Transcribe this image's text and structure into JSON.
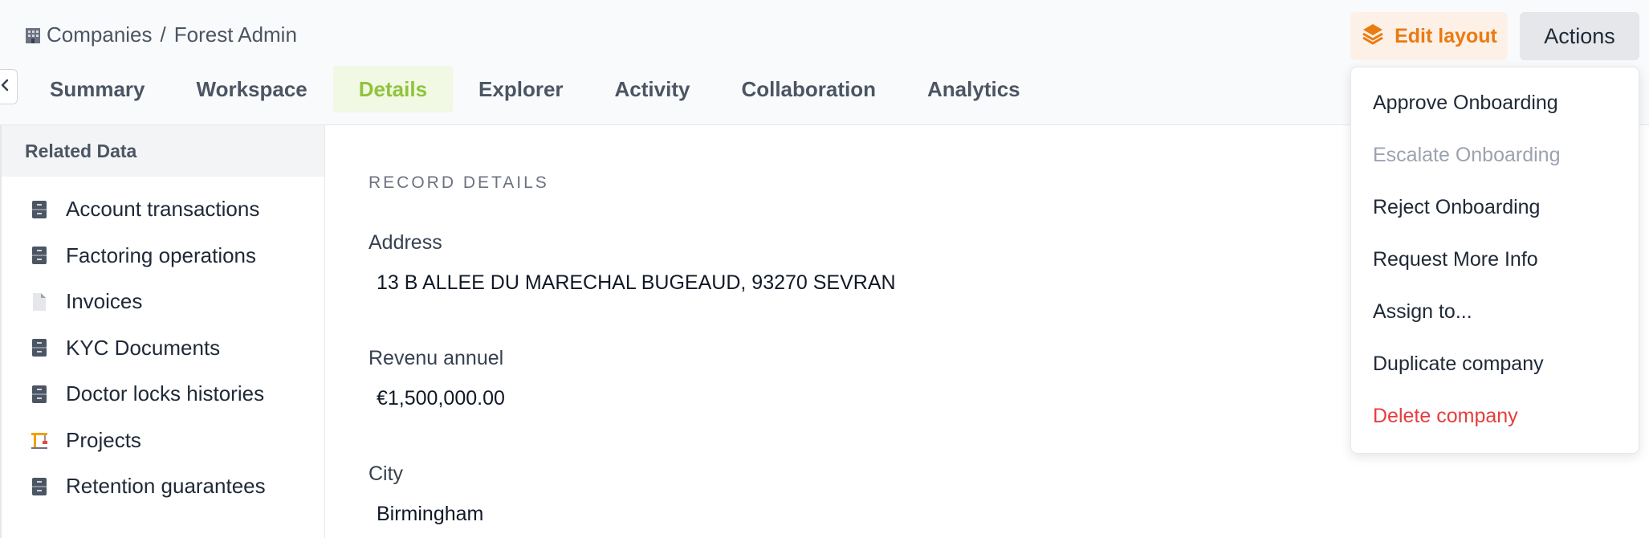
{
  "breadcrumb": {
    "icon": "office-building-icon",
    "parent": "Companies",
    "separator": "/",
    "current": "Forest Admin"
  },
  "header": {
    "edit_layout_label": "Edit layout",
    "edit_layout_icon": "layers-icon",
    "actions_label": "Actions",
    "accent_color": "#ea7a12"
  },
  "tabs": [
    {
      "label": "Summary",
      "active": false
    },
    {
      "label": "Workspace",
      "active": false
    },
    {
      "label": "Details",
      "active": true
    },
    {
      "label": "Explorer",
      "active": false
    },
    {
      "label": "Activity",
      "active": false
    },
    {
      "label": "Collaboration",
      "active": false
    },
    {
      "label": "Analytics",
      "active": false
    }
  ],
  "sidebar": {
    "header": "Related Data",
    "items": [
      {
        "label": "Account transactions",
        "icon": "file-cabinet-icon"
      },
      {
        "label": "Factoring operations",
        "icon": "file-cabinet-icon"
      },
      {
        "label": "Invoices",
        "icon": "page-icon"
      },
      {
        "label": "KYC Documents",
        "icon": "file-cabinet-icon"
      },
      {
        "label": "Doctor locks histories",
        "icon": "file-cabinet-icon"
      },
      {
        "label": "Projects",
        "icon": "construction-crane-icon"
      },
      {
        "label": "Retention guarantees",
        "icon": "file-cabinet-icon"
      }
    ]
  },
  "main": {
    "section_title": "RECORD DETAILS",
    "fields": [
      {
        "label": "Address",
        "value": "13 B ALLEE DU MARECHAL BUGEAUD, 93270 SEVRAN"
      },
      {
        "label": "Revenu annuel",
        "value": "€1,500,000.00"
      },
      {
        "label": "City",
        "value": "Birmingham"
      }
    ]
  },
  "actions_menu": {
    "items": [
      {
        "label": "Approve Onboarding",
        "state": "normal"
      },
      {
        "label": "Escalate Onboarding",
        "state": "disabled"
      },
      {
        "label": "Reject Onboarding",
        "state": "normal"
      },
      {
        "label": "Request More Info",
        "state": "normal"
      },
      {
        "label": "Assign to...",
        "state": "normal"
      },
      {
        "label": "Duplicate company",
        "state": "normal"
      },
      {
        "label": "Delete company",
        "state": "danger"
      }
    ],
    "danger_color": "#e53e3e",
    "disabled_color": "#9ca3af"
  },
  "tab_active_color": "#8fc43a"
}
